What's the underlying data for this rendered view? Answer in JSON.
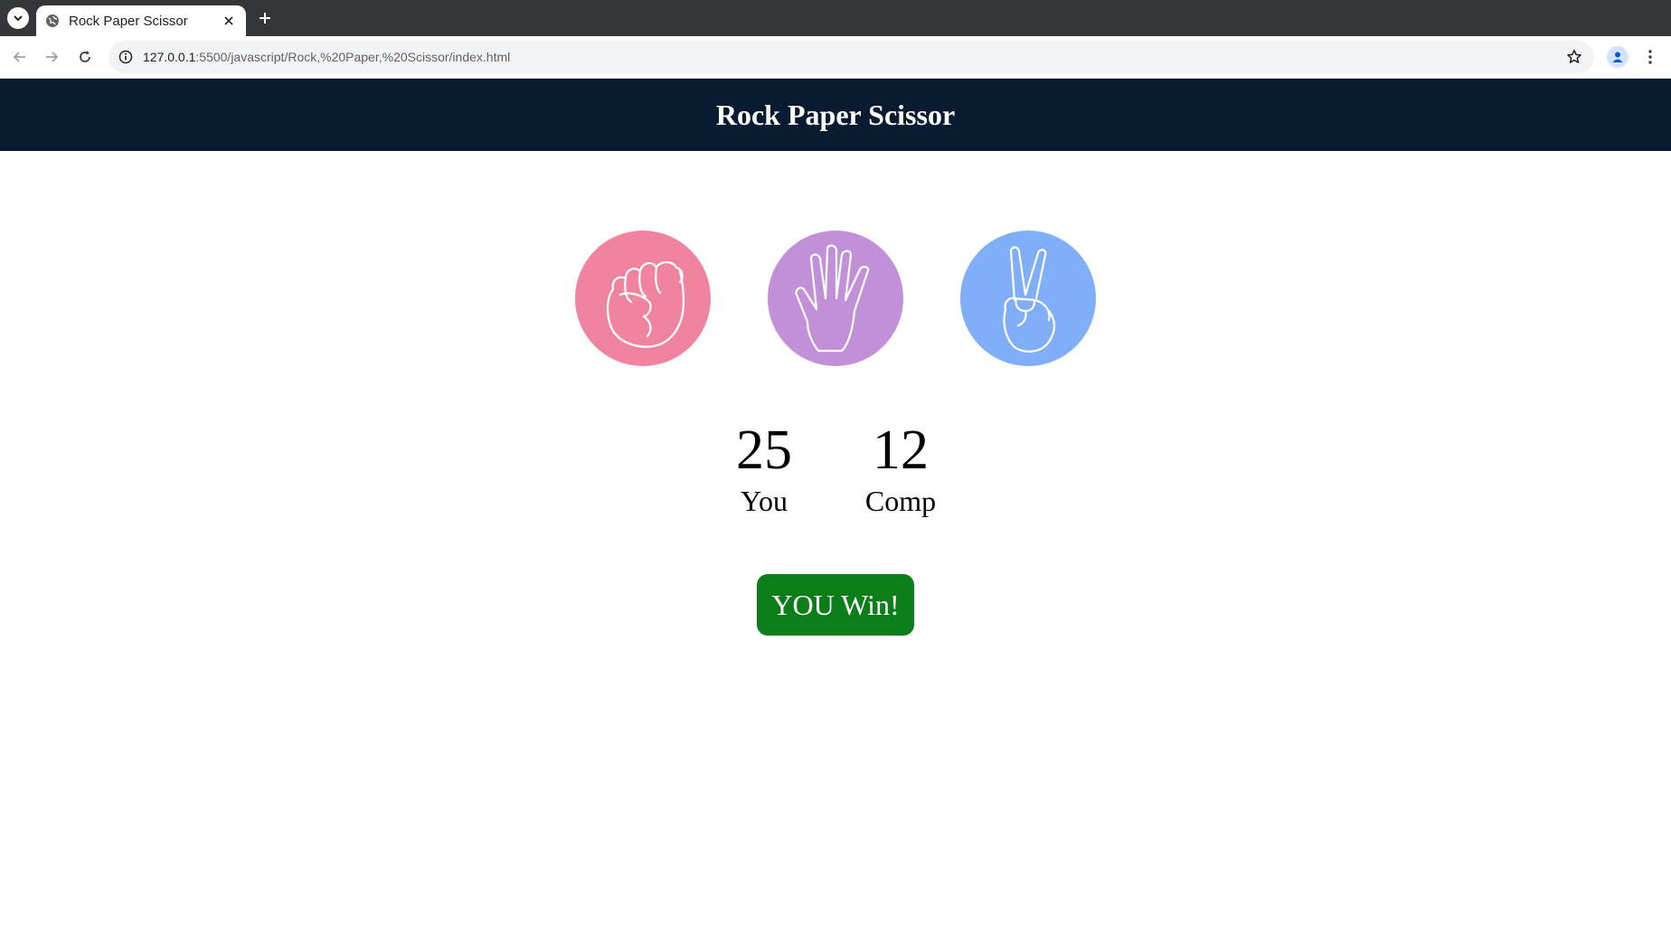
{
  "browser": {
    "tab_title": "Rock Paper Scissor",
    "url_host": "127.0.0.1",
    "url_rest": ":5500/javascript/Rock,%20Paper,%20Scissor/index.html"
  },
  "page": {
    "title": "Rock Paper Scissor"
  },
  "choices": [
    {
      "name": "rock",
      "color": "#f083a0"
    },
    {
      "name": "paper",
      "color": "#c190d8"
    },
    {
      "name": "scissor",
      "color": "#80aef8"
    }
  ],
  "scores": {
    "user": {
      "value": "25",
      "label": "You"
    },
    "comp": {
      "value": "12",
      "label": "Comp"
    }
  },
  "message": {
    "text": "YOU Win!",
    "color": "#0b7e19"
  },
  "colors": {
    "header_bg": "#081b31",
    "chrome_dark": "#35363a"
  }
}
